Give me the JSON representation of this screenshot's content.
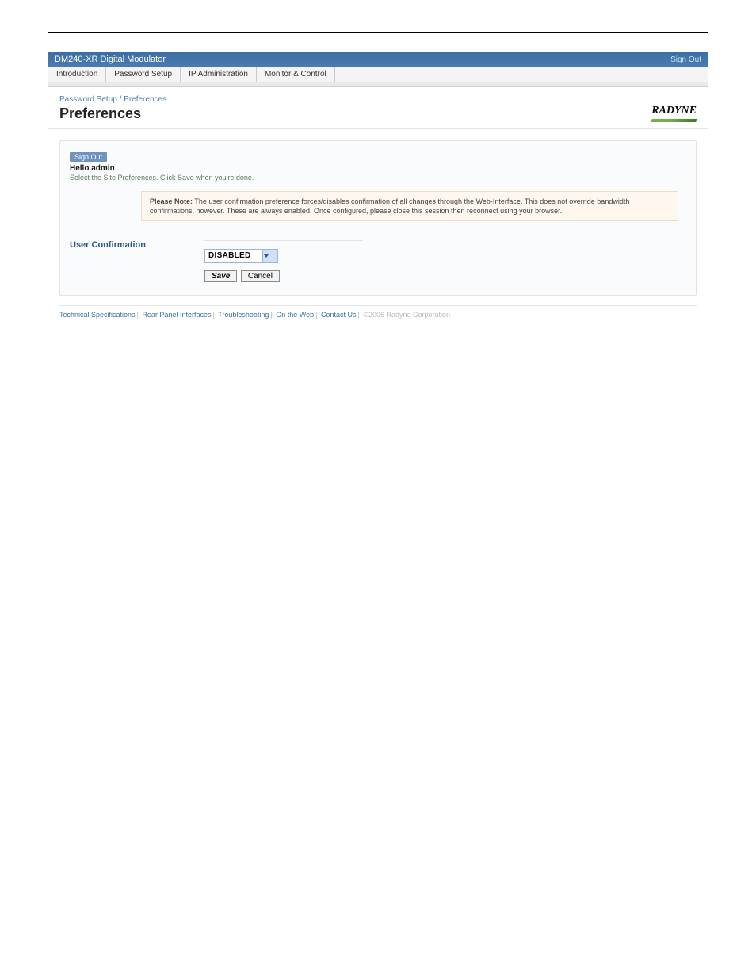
{
  "window": {
    "title": "DM240-XR Digital Modulator",
    "sign_out": "Sign Out"
  },
  "menu": {
    "items": [
      "Introduction",
      "Password Setup",
      "IP Administration",
      "Monitor & Control"
    ]
  },
  "breadcrumb": "Password Setup / Preferences",
  "page_title": "Preferences",
  "logo_text": "RADYNE",
  "panel": {
    "sign_out_pill": "Sign Out",
    "hello": "Hello admin",
    "instruction": "Select the Site Preferences. Click Save when you're done.",
    "note_label": "Please Note:",
    "note_text": " The user confirmation preference forces/disables confirmation of all changes through the Web-Interface. This does not override bandwidth confirmations, however. These are always enabled. Once configured, please close this session then reconnect using your browser.",
    "form": {
      "label": "User Confirmation",
      "select_value": "DISABLED",
      "save_label": "Save",
      "cancel_label": "Cancel"
    }
  },
  "footer": {
    "links": [
      "Technical Specifications",
      "Rear Panel Interfaces",
      "Troubleshooting",
      "On the Web",
      "Contact Us"
    ],
    "copyright": "©2006 Radyne Corporation"
  }
}
